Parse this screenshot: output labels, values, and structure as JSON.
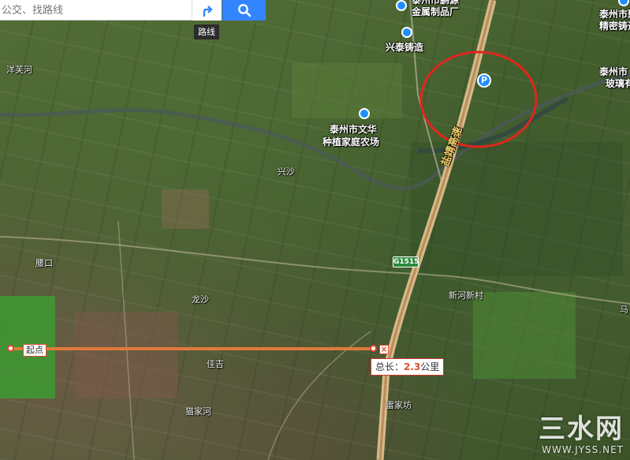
{
  "search": {
    "placeholder": "公交、找路线"
  },
  "toolbar": {
    "route_tooltip": "路线",
    "route_icon": "route-icon",
    "search_icon": "search-icon"
  },
  "pois": {
    "metal_factory": "金属制品厂",
    "metal_factory_top": "泰州市鹏源",
    "xingtai": "兴泰铸造",
    "jvli_1": "泰州市聚利",
    "jvli_2": "精密铸造厂",
    "glass_1": "泰州市",
    "glass_2": "玻璃有",
    "farm_1": "泰州市文华",
    "farm_2": "种植家庭农场",
    "parking": "P"
  },
  "villages": {
    "v1": "洋芙河",
    "v2": "兴沙",
    "v3": "腰口",
    "v4": "龙沙",
    "v5": "佳吉",
    "v6": "猫家河",
    "v7": "新河新村",
    "v8": "雷家坊",
    "v9": "马"
  },
  "road": {
    "highway_shield": "G1515",
    "highway_name": "盐靖高速"
  },
  "measure": {
    "start_label": "起点",
    "close_symbol": "×",
    "total_prefix": "总长：",
    "total_value": "2.3",
    "total_unit": "公里"
  },
  "watermark": {
    "title": "三水网",
    "url": "WWW.JYSS.NET"
  },
  "colors": {
    "measure_line": "#e07a3a",
    "highlight_circle": "#e0261e",
    "search_button": "#3385ff"
  }
}
